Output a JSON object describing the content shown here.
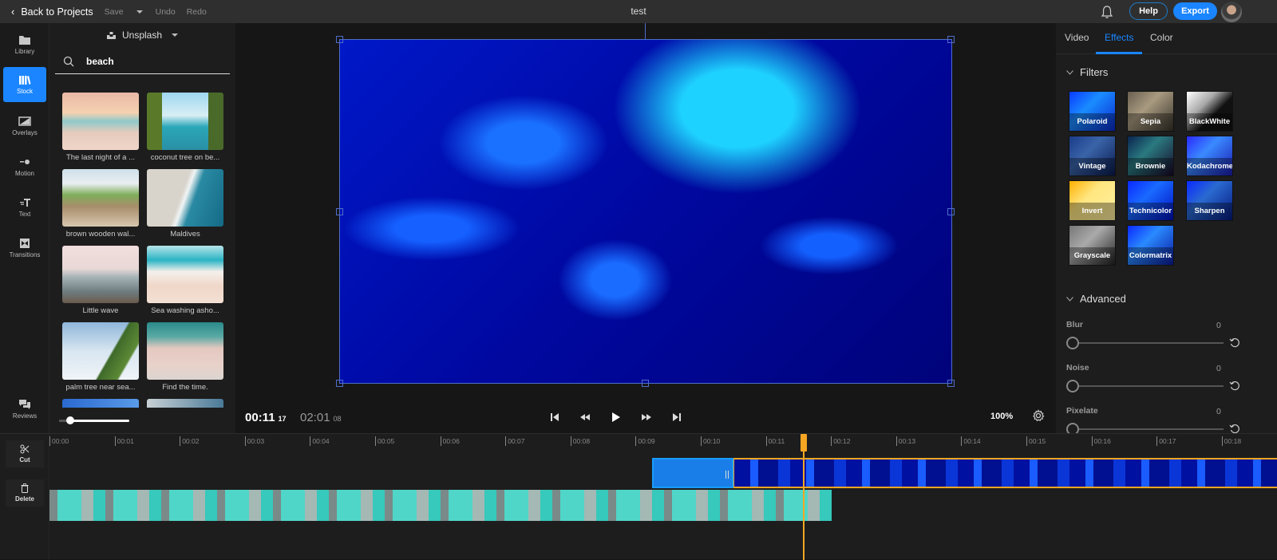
{
  "topbar": {
    "back_label": "Back to Projects",
    "save_label": "Save",
    "undo_label": "Undo",
    "redo_label": "Redo",
    "project_title": "test",
    "help_label": "Help",
    "export_label": "Export",
    "accent_color": "#1a85ff"
  },
  "leftnav": {
    "items": [
      {
        "label": "Library",
        "icon": "folder-icon"
      },
      {
        "label": "Stock",
        "icon": "books-icon",
        "active": true
      },
      {
        "label": "Overlays",
        "icon": "overlay-icon"
      },
      {
        "label": "Motion",
        "icon": "motion-icon"
      },
      {
        "label": "Text",
        "icon": "text-icon"
      },
      {
        "label": "Transitions",
        "icon": "transition-icon"
      },
      {
        "label": "Reviews",
        "icon": "chat-icon"
      }
    ]
  },
  "stock": {
    "source": "Unsplash",
    "search_value": "beach",
    "items": [
      {
        "caption": "The last night of a ..."
      },
      {
        "caption": "coconut tree on be..."
      },
      {
        "caption": "brown wooden wal..."
      },
      {
        "caption": "Maldives"
      },
      {
        "caption": "Little wave"
      },
      {
        "caption": "Sea washing asho..."
      },
      {
        "caption": "palm tree near sea..."
      },
      {
        "caption": "Find the time."
      },
      {
        "caption": ""
      },
      {
        "caption": ""
      }
    ],
    "thumb_size_fraction": 0.15
  },
  "preview": {
    "current_time": "00:11",
    "current_frame": "17",
    "total_time": "02:01",
    "total_frame": "08",
    "zoom": "100%"
  },
  "right": {
    "tabs": [
      {
        "label": "Video"
      },
      {
        "label": "Effects",
        "active": true
      },
      {
        "label": "Color"
      }
    ],
    "filters_title": "Filters",
    "filters": [
      {
        "label": "Polaroid"
      },
      {
        "label": "Sepia"
      },
      {
        "label": "BlackWhite"
      },
      {
        "label": "Vintage"
      },
      {
        "label": "Brownie"
      },
      {
        "label": "Kodachrome"
      },
      {
        "label": "Invert"
      },
      {
        "label": "Technicolor"
      },
      {
        "label": "Sharpen"
      },
      {
        "label": "Grayscale"
      },
      {
        "label": "Colormatrix"
      }
    ],
    "advanced_title": "Advanced",
    "advanced": [
      {
        "label": "Blur",
        "value": "0"
      },
      {
        "label": "Noise",
        "value": "0"
      },
      {
        "label": "Pixelate",
        "value": "0"
      }
    ]
  },
  "timeline": {
    "tools": [
      {
        "label": "Cut",
        "icon": "scissors-icon"
      },
      {
        "label": "Delete",
        "icon": "trash-icon"
      }
    ],
    "ticks": [
      "00:00",
      "00:01",
      "00:02",
      "00:03",
      "00:04",
      "00:05",
      "00:06",
      "00:07",
      "00:08",
      "00:09",
      "00:10",
      "00:11",
      "00:12",
      "00:13",
      "00:14",
      "00:15",
      "00:16",
      "00:17",
      "00:18"
    ],
    "playhead_time": "00:11.17"
  }
}
